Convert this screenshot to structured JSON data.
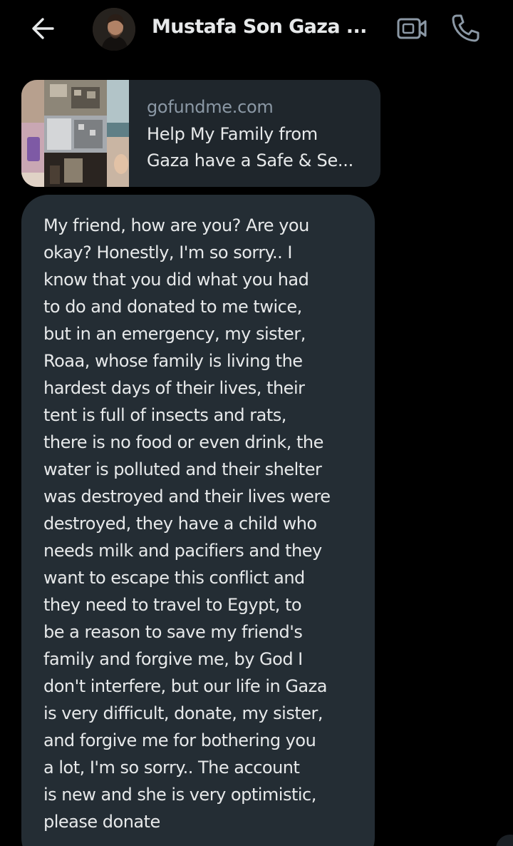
{
  "header": {
    "contact_name": "Mustafa Son Gaza ...",
    "back_icon": "arrow-left-icon",
    "video_icon": "video-camera-icon",
    "call_icon": "phone-icon"
  },
  "link_preview": {
    "domain": "gofundme.com",
    "title_lines": [
      "Help My Family from",
      "Gaza have a Safe & Se..."
    ]
  },
  "message": {
    "lines": [
      "My friend, how are you? Are you",
      "okay? Honestly, I'm so sorry.. I",
      "know that you did what you had",
      "to do and donated to me twice,",
      "but in an emergency, my sister,",
      "Roaa, whose family is living the",
      "hardest days of their lives, their",
      "tent is full of insects and rats,",
      "there is no food or even drink, the",
      "water is polluted and their shelter",
      "was destroyed and their lives were",
      "destroyed, they have a child who",
      "needs milk and pacifiers and they",
      "want to escape this conflict and",
      "they need to travel to Egypt, to",
      "be a reason to save my friend's",
      "family and forgive me, by God I",
      "don't interfere, but our life in Gaza",
      "is very difficult, donate, my sister,",
      "and forgive me for bothering you",
      "a lot, I'm so sorry.. The account",
      "is new and she is very optimistic,",
      "please donate"
    ]
  },
  "colors": {
    "background": "#000000",
    "bubble": "#242d34",
    "card": "#1f262c",
    "text": "#e7e9ea",
    "muted": "#8b98a5"
  }
}
